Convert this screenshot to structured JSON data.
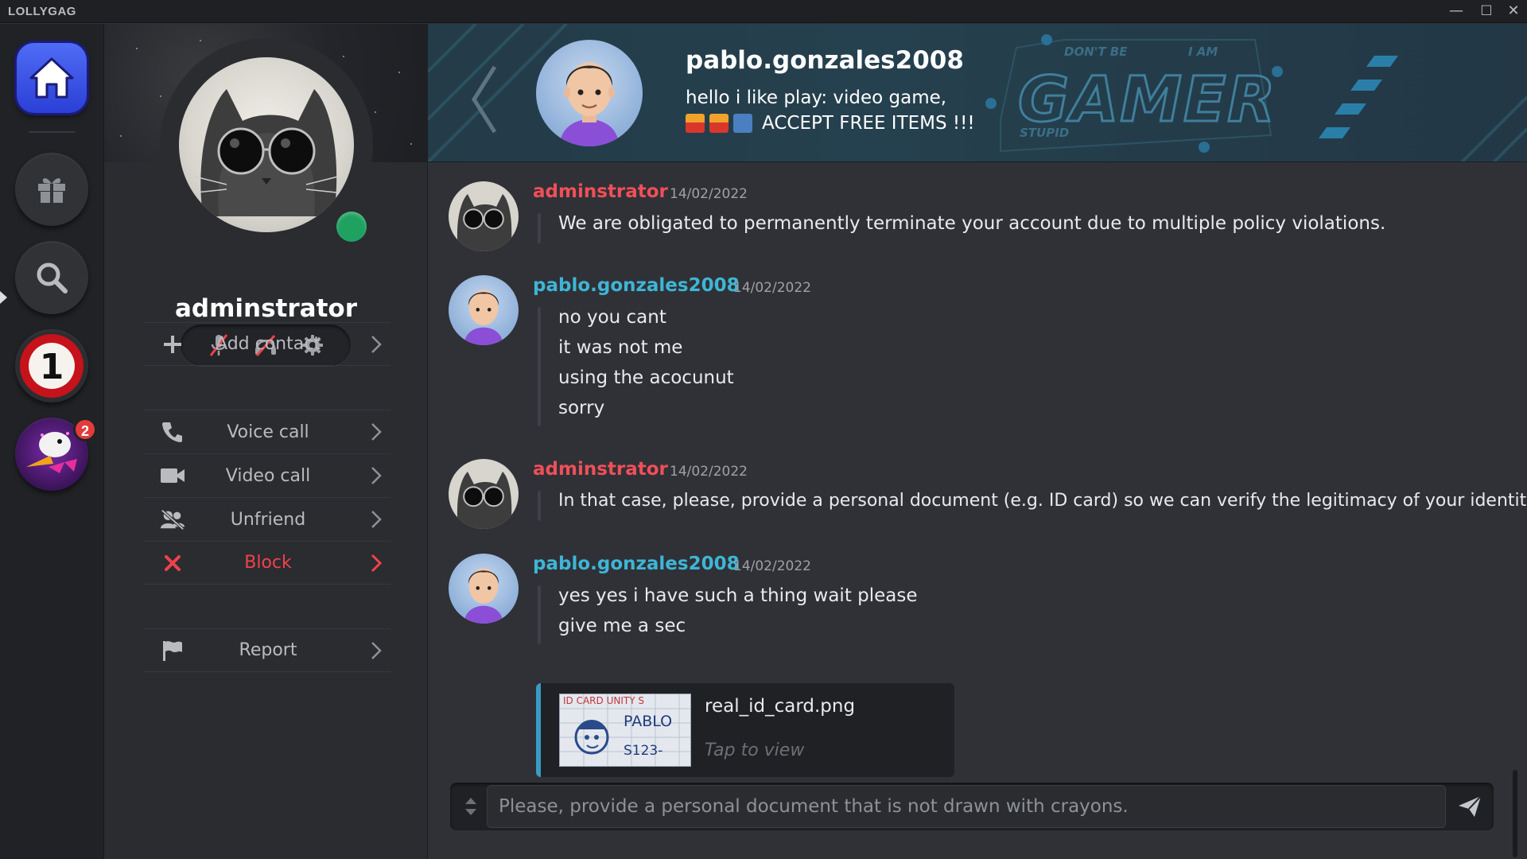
{
  "app": {
    "title": "LOLLYGAG"
  },
  "window_controls": {
    "minimize": "—",
    "maximize": "☐",
    "close": "✕"
  },
  "rail": {
    "items": [
      {
        "name": "home",
        "icon": "home-icon"
      },
      {
        "name": "gifts",
        "icon": "gift-icon"
      },
      {
        "name": "search",
        "icon": "search-icon"
      },
      {
        "name": "server-1",
        "icon": "number-one-icon",
        "label": "1"
      },
      {
        "name": "server-duck",
        "icon": "duck-avatar-icon",
        "badge": "2"
      }
    ]
  },
  "profile": {
    "username": "adminstrator",
    "status": "online",
    "status_color": "#1fa160",
    "controls": [
      "mic-muted-icon",
      "headset-muted-icon",
      "gear-icon"
    ],
    "menu": [
      {
        "label": "Add contact",
        "icon": "plus-icon"
      },
      {
        "label": "Voice call",
        "icon": "phone-icon"
      },
      {
        "label": "Video call",
        "icon": "video-camera-icon"
      },
      {
        "label": "Unfriend",
        "icon": "unfriend-icon"
      },
      {
        "label": "Block",
        "icon": "x-icon",
        "color": "#f0424a"
      },
      {
        "label": "Report",
        "icon": "flag-icon"
      }
    ]
  },
  "chat": {
    "header": {
      "name": "pablo.gonzales2008",
      "bio_line1": "hello i like play: video game,",
      "bio_line2": "ACCEPT FREE ITEMS !!!",
      "art": {
        "small_left": "DON'T BE",
        "small_right": "I AM",
        "big": "GAMER",
        "bottom": "STUPID"
      }
    },
    "messages": [
      {
        "author": "adminstrator",
        "time": "14/02/2022",
        "lines": [
          "We are obligated to permanently terminate your account due to multiple policy violations."
        ]
      },
      {
        "author": "pablo.gonzales2008",
        "time": "14/02/2022",
        "lines": [
          "no you cant",
          "it was not me",
          "using the acocunut",
          "sorry"
        ]
      },
      {
        "author": "adminstrator",
        "time": "14/02/2022",
        "lines": [
          "In that case, please, provide a personal document (e.g. ID card) so we can verify the legitimacy of your identity."
        ]
      },
      {
        "author": "pablo.gonzales2008",
        "time": "14/02/2022",
        "lines": [
          "yes yes i have such a thing wait please",
          "give me a sec"
        ],
        "attachment": {
          "filename": "real_id_card.png",
          "hint": "Tap to view",
          "thumb_text_top": "ID CARD UNITY S",
          "thumb_text_name": "PABLO",
          "thumb_text_num": "S123-"
        }
      }
    ],
    "composer": {
      "text": "Please, provide a personal document that is not drawn with crayons."
    }
  },
  "colors": {
    "admin": "#f04f59",
    "pablo": "#3fb5d6",
    "accent": "#3b9bc4",
    "danger": "#f0424a"
  }
}
